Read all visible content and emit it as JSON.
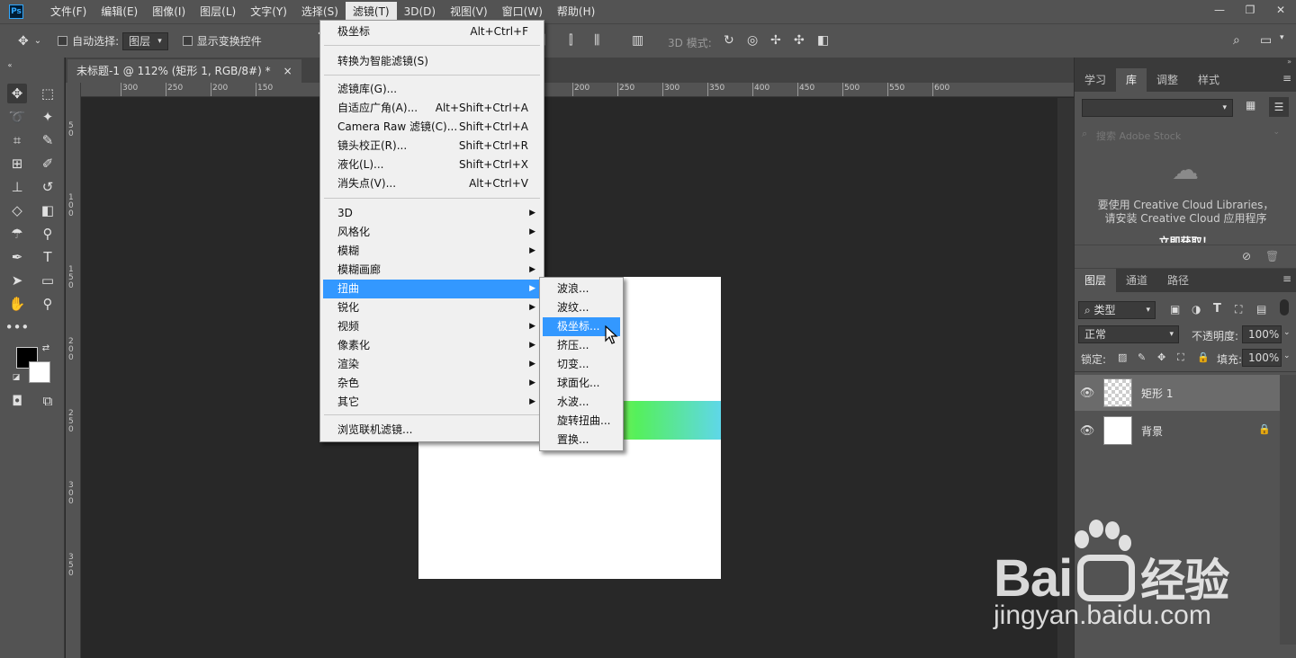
{
  "menubar": {
    "items": [
      "文件(F)",
      "编辑(E)",
      "图像(I)",
      "图层(L)",
      "文字(Y)",
      "选择(S)",
      "滤镜(T)",
      "3D(D)",
      "视图(V)",
      "窗口(W)",
      "帮助(H)"
    ],
    "active_index": 6
  },
  "app": {
    "logo": "Ps"
  },
  "options": {
    "auto_select_label": "自动选择:",
    "auto_select_value": "图层",
    "show_transform_label": "显示变换控件",
    "mode_3d_label": "3D 模式:"
  },
  "document": {
    "tab_title": "未标题-1 @ 112% (矩形 1, RGB/8#) *",
    "tab_close": "×"
  },
  "ruler": {
    "h_labels": [
      "300",
      "250",
      "200",
      "150",
      "150",
      "200",
      "250",
      "300",
      "350",
      "400",
      "450",
      "500",
      "550",
      "600"
    ],
    "v_labels": [
      "50",
      "100",
      "150",
      "200",
      "250",
      "300",
      "350"
    ]
  },
  "filter_menu": {
    "items": [
      {
        "label": "极坐标",
        "shortcut": "Alt+Ctrl+F"
      },
      {
        "label": "转换为智能滤镜(S)",
        "shortcut": ""
      },
      {
        "label": "滤镜库(G)...",
        "shortcut": ""
      },
      {
        "label": "自适应广角(A)...",
        "shortcut": "Alt+Shift+Ctrl+A"
      },
      {
        "label": "Camera Raw 滤镜(C)...",
        "shortcut": "Shift+Ctrl+A"
      },
      {
        "label": "镜头校正(R)...",
        "shortcut": "Shift+Ctrl+R"
      },
      {
        "label": "液化(L)...",
        "shortcut": "Shift+Ctrl+X"
      },
      {
        "label": "消失点(V)...",
        "shortcut": "Alt+Ctrl+V"
      },
      {
        "label": "3D",
        "shortcut": ""
      },
      {
        "label": "风格化",
        "shortcut": ""
      },
      {
        "label": "模糊",
        "shortcut": ""
      },
      {
        "label": "模糊画廊",
        "shortcut": ""
      },
      {
        "label": "扭曲",
        "shortcut": ""
      },
      {
        "label": "锐化",
        "shortcut": ""
      },
      {
        "label": "视频",
        "shortcut": ""
      },
      {
        "label": "像素化",
        "shortcut": ""
      },
      {
        "label": "渲染",
        "shortcut": ""
      },
      {
        "label": "杂色",
        "shortcut": ""
      },
      {
        "label": "其它",
        "shortcut": ""
      },
      {
        "label": "浏览联机滤镜...",
        "shortcut": ""
      }
    ]
  },
  "distort_submenu": {
    "items": [
      "波浪...",
      "波纹...",
      "极坐标...",
      "挤压...",
      "切变...",
      "球面化...",
      "水波...",
      "旋转扭曲...",
      "置换..."
    ]
  },
  "library_panel": {
    "tabs": [
      "学习",
      "库",
      "调整",
      "样式"
    ],
    "search_placeholder": "搜索 Adobe Stock",
    "message_line1": "要使用 Creative Cloud Libraries，",
    "message_line2": "请安装 Creative Cloud 应用程序",
    "link": "立即获取！"
  },
  "layers_panel": {
    "tabs": [
      "图层",
      "通道",
      "路径"
    ],
    "filter_kind": "类型",
    "blend_mode": "正常",
    "opacity_label": "不透明度:",
    "opacity_value": "100%",
    "lock_label": "锁定:",
    "fill_label": "填充:",
    "fill_value": "100%",
    "layers": [
      {
        "name": "矩形 1",
        "selected": true
      },
      {
        "name": "背景",
        "selected": false
      }
    ]
  },
  "watermark": {
    "brand": "Bai",
    "brand_cn": "经验",
    "url": "jingyan.baidu.com"
  },
  "colors": {
    "menu_highlight": "#3398ff",
    "ui_bg": "#535353",
    "canvas_bg": "#282828"
  }
}
